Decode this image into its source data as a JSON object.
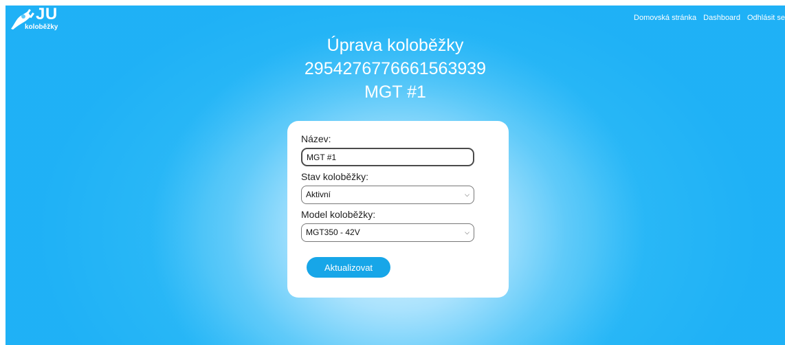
{
  "brand": {
    "logo_text": "JU",
    "logo_subtext": "koloběžky"
  },
  "nav": {
    "items": [
      "Domovská stránka",
      "Dashboard",
      "Odhlásit se"
    ]
  },
  "page": {
    "title": "Úprava koloběžky",
    "scooter_id": "2954276776661563939",
    "scooter_name": "MGT #1"
  },
  "form": {
    "name_label": "Název:",
    "name_value": "MGT #1",
    "state_label": "Stav koloběžky:",
    "state_selected": "Aktivní",
    "model_label": "Model koloběžky:",
    "model_selected": "MGT350 - 42V",
    "submit_label": "Aktualizovat"
  },
  "colors": {
    "background": "#2dbaf7",
    "button": "#17a6e8",
    "card": "#ffffff"
  },
  "icons": {
    "logo": "plug-icon",
    "select_arrow": "chevron-down-icon"
  }
}
